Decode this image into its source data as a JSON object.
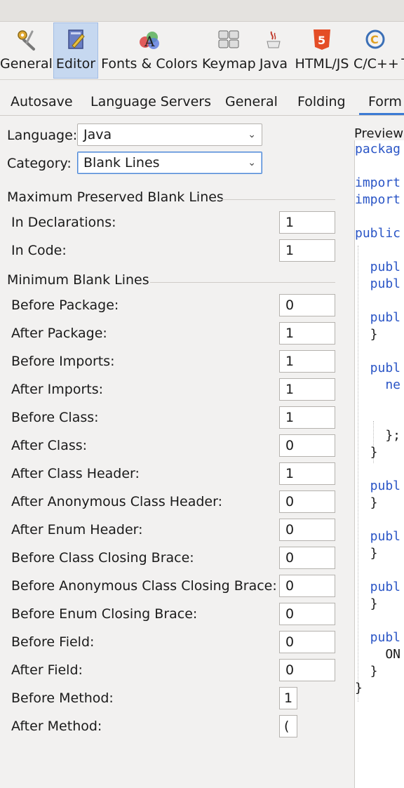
{
  "toolbar": {
    "items": [
      {
        "label": "General",
        "icon": "gear-icon"
      },
      {
        "label": "Editor",
        "icon": "editor-icon"
      },
      {
        "label": "Fonts & Colors",
        "icon": "fonts-colors-icon"
      },
      {
        "label": "Keymap",
        "icon": "keymap-icon"
      },
      {
        "label": "Java",
        "icon": "java-icon"
      },
      {
        "label": "HTML/JS",
        "icon": "html5-icon"
      },
      {
        "label": "C/C++",
        "icon": "cpp-icon"
      },
      {
        "label": "T",
        "icon": ""
      }
    ],
    "selected": "Editor"
  },
  "subtabs": [
    "Autosave",
    "Language Servers",
    "General",
    "Folding",
    "Form"
  ],
  "language": {
    "label": "Language:",
    "value": "Java"
  },
  "category": {
    "label": "Category:",
    "value": "Blank Lines"
  },
  "sections": {
    "max_preserved": "Maximum Preserved Blank Lines",
    "min_blank": "Minimum Blank Lines"
  },
  "max_preserved": [
    {
      "label": "In Declarations:",
      "value": "1"
    },
    {
      "label": "In Code:",
      "value": "1"
    }
  ],
  "min_blank": [
    {
      "label": "Before Package:",
      "value": "0"
    },
    {
      "label": "After Package:",
      "value": "1"
    },
    {
      "label": "Before Imports:",
      "value": "1"
    },
    {
      "label": "After Imports:",
      "value": "1"
    },
    {
      "label": "Before Class:",
      "value": "1"
    },
    {
      "label": "After Class:",
      "value": "0"
    },
    {
      "label": "After Class Header:",
      "value": "1"
    },
    {
      "label": "After Anonymous Class Header:",
      "value": "0"
    },
    {
      "label": "After Enum Header:",
      "value": "0"
    },
    {
      "label": "Before Class Closing Brace:",
      "value": "0"
    },
    {
      "label": "Before Anonymous Class Closing Brace:",
      "value": "0"
    },
    {
      "label": "Before Enum Closing Brace:",
      "value": "0"
    },
    {
      "label": "Before Field:",
      "value": "0"
    },
    {
      "label": "After Field:",
      "value": "0"
    },
    {
      "label": "Before Method:",
      "value": "1"
    },
    {
      "label": "After Method:",
      "value": "("
    }
  ],
  "preview": {
    "label": "Preview",
    "lines": [
      {
        "text": "packag",
        "kw": true
      },
      {
        "text": "",
        "kw": false
      },
      {
        "text": "import",
        "kw": true
      },
      {
        "text": "import",
        "kw": true
      },
      {
        "text": "",
        "kw": false
      },
      {
        "text": "public",
        "kw": true
      },
      {
        "text": "",
        "kw": false
      },
      {
        "text": "  publ",
        "kw": true
      },
      {
        "text": "  publ",
        "kw": true
      },
      {
        "text": "",
        "kw": false
      },
      {
        "text": "  publ",
        "kw": true
      },
      {
        "text": "  }",
        "kw": false
      },
      {
        "text": "",
        "kw": false
      },
      {
        "text": "  publ",
        "kw": true
      },
      {
        "text": "    ne",
        "kw": true
      },
      {
        "text": "",
        "kw": false
      },
      {
        "text": "",
        "kw": false
      },
      {
        "text": "    };",
        "kw": false
      },
      {
        "text": "  }",
        "kw": false
      },
      {
        "text": "",
        "kw": false
      },
      {
        "text": "  publ",
        "kw": true
      },
      {
        "text": "  }",
        "kw": false
      },
      {
        "text": "",
        "kw": false
      },
      {
        "text": "  publ",
        "kw": true
      },
      {
        "text": "  }",
        "kw": false
      },
      {
        "text": "",
        "kw": false
      },
      {
        "text": "  publ",
        "kw": true
      },
      {
        "text": "  }",
        "kw": false
      },
      {
        "text": "",
        "kw": false
      },
      {
        "text": "  publ",
        "kw": true
      },
      {
        "text": "    ON",
        "kw": false
      },
      {
        "text": "  }",
        "kw": false
      },
      {
        "text": "}",
        "kw": false
      }
    ]
  },
  "colors": {
    "accent": "#3d7bd4",
    "keyword": "#2a55c6",
    "selected_bg": "#c6d8f0"
  }
}
